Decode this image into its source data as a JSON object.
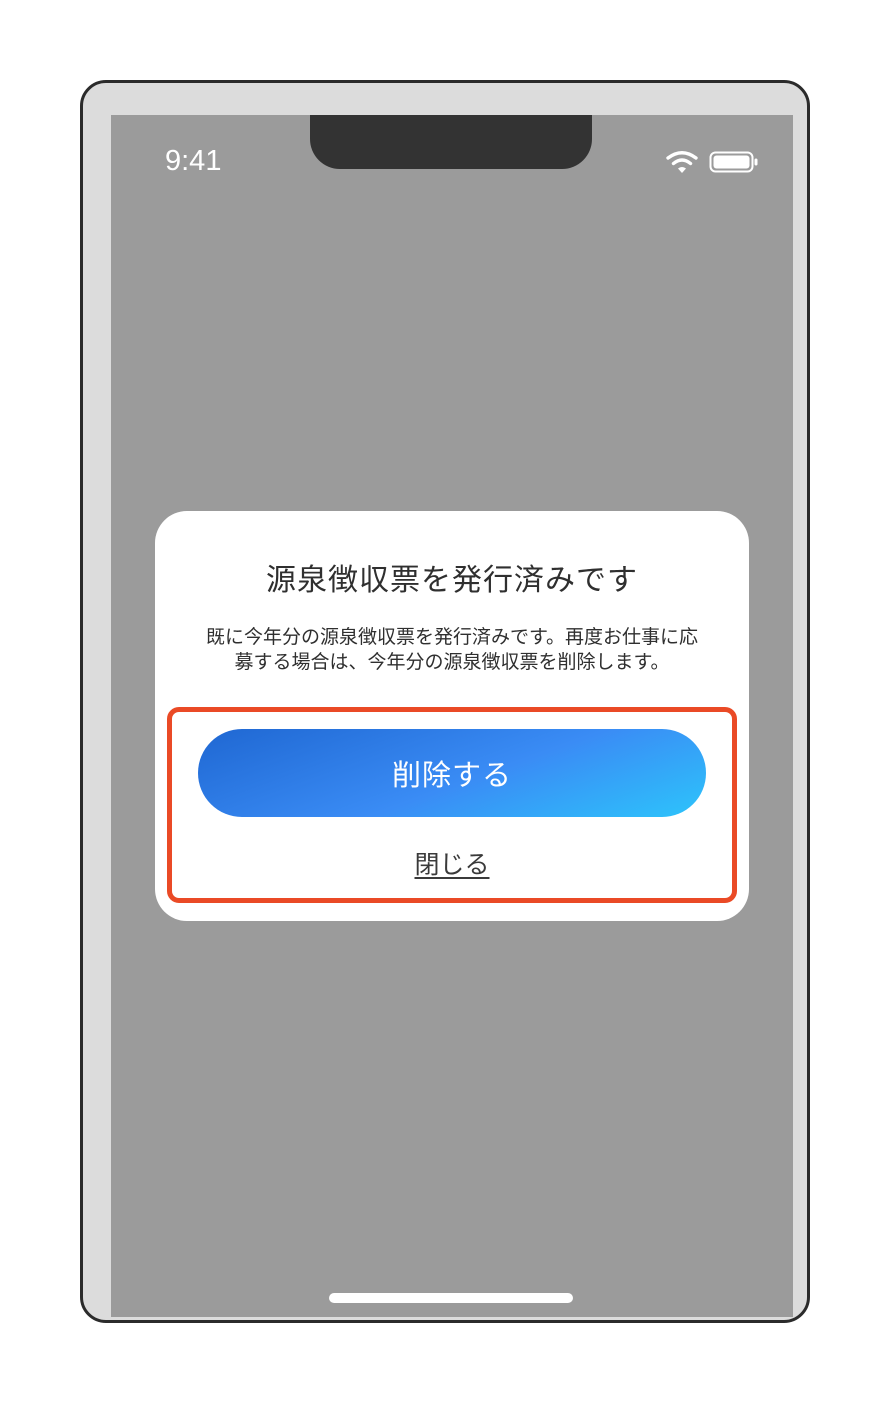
{
  "status_bar": {
    "time": "9:41",
    "wifi_icon": "wifi-icon",
    "battery_icon": "battery-icon"
  },
  "dialog": {
    "title": "源泉徴収票を発行済みです",
    "message": "既に今年分の源泉徴収票を発行済みです。再度お仕事に応募する場合は、今年分の源泉徴収票を削除します。",
    "primary_button_label": "削除する",
    "close_label": "閉じる"
  },
  "colors": {
    "overlay": "#9b9b9b",
    "highlight_border": "#ea4a26",
    "button_gradient_start": "#1f67d2",
    "button_gradient_end": "#2dc4fb"
  }
}
